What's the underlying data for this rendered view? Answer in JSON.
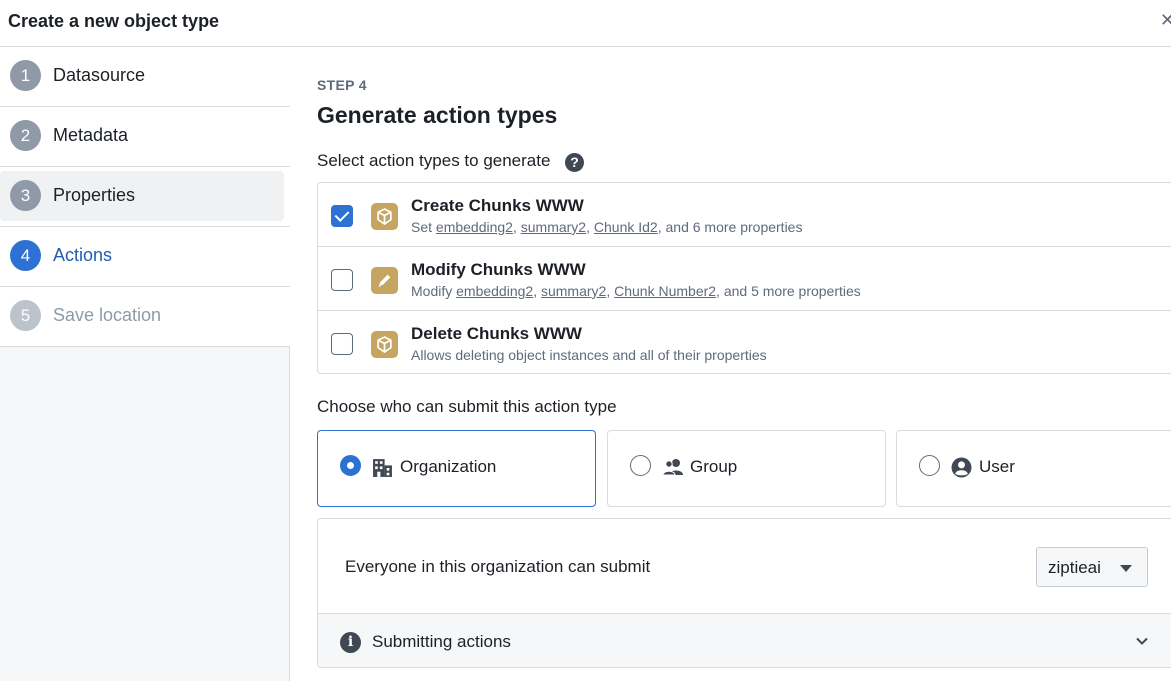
{
  "header": {
    "title": "Create a new object type",
    "close_glyph": "✕"
  },
  "sidebar": {
    "steps": [
      {
        "num": "1",
        "label": "Datasource",
        "state": "done"
      },
      {
        "num": "2",
        "label": "Metadata",
        "state": "done"
      },
      {
        "num": "3",
        "label": "Properties",
        "state": "hovered"
      },
      {
        "num": "4",
        "label": "Actions",
        "state": "active"
      },
      {
        "num": "5",
        "label": "Save location",
        "state": "disabled"
      }
    ]
  },
  "main": {
    "kicker": "STEP 4",
    "title": "Generate action types",
    "select_label": "Select action types to generate",
    "help_glyph": "?",
    "actions": [
      {
        "title": "Create Chunks WWW",
        "checked": true,
        "icon": "cube-icon",
        "desc_prefix": "Set ",
        "links": [
          "embedding2",
          "summary2",
          "Chunk Id2"
        ],
        "desc_suffix": ", and 6 more properties"
      },
      {
        "title": "Modify Chunks WWW",
        "checked": false,
        "icon": "pencil-icon",
        "desc_prefix": "Modify ",
        "links": [
          "embedding2",
          "summary2",
          "Chunk Number2"
        ],
        "desc_suffix": ", and 5 more properties"
      },
      {
        "title": "Delete Chunks WWW",
        "checked": false,
        "icon": "cube-icon",
        "desc": "Allows deleting object instances and all of their properties"
      }
    ],
    "choose_label": "Choose who can submit this action type",
    "submitters": [
      {
        "label": "Organization",
        "selected": true,
        "icon": "building-icon"
      },
      {
        "label": "Group",
        "selected": false,
        "icon": "people-icon"
      },
      {
        "label": "User",
        "selected": false,
        "icon": "user-icon"
      }
    ],
    "everyone_text": "Everyone in this organization can submit",
    "org_select_value": "ziptieai",
    "submitting_label": "Submitting actions",
    "info_glyph": "i"
  },
  "colors": {
    "accent": "#2d72d2",
    "object_icon": "#c5a560"
  }
}
